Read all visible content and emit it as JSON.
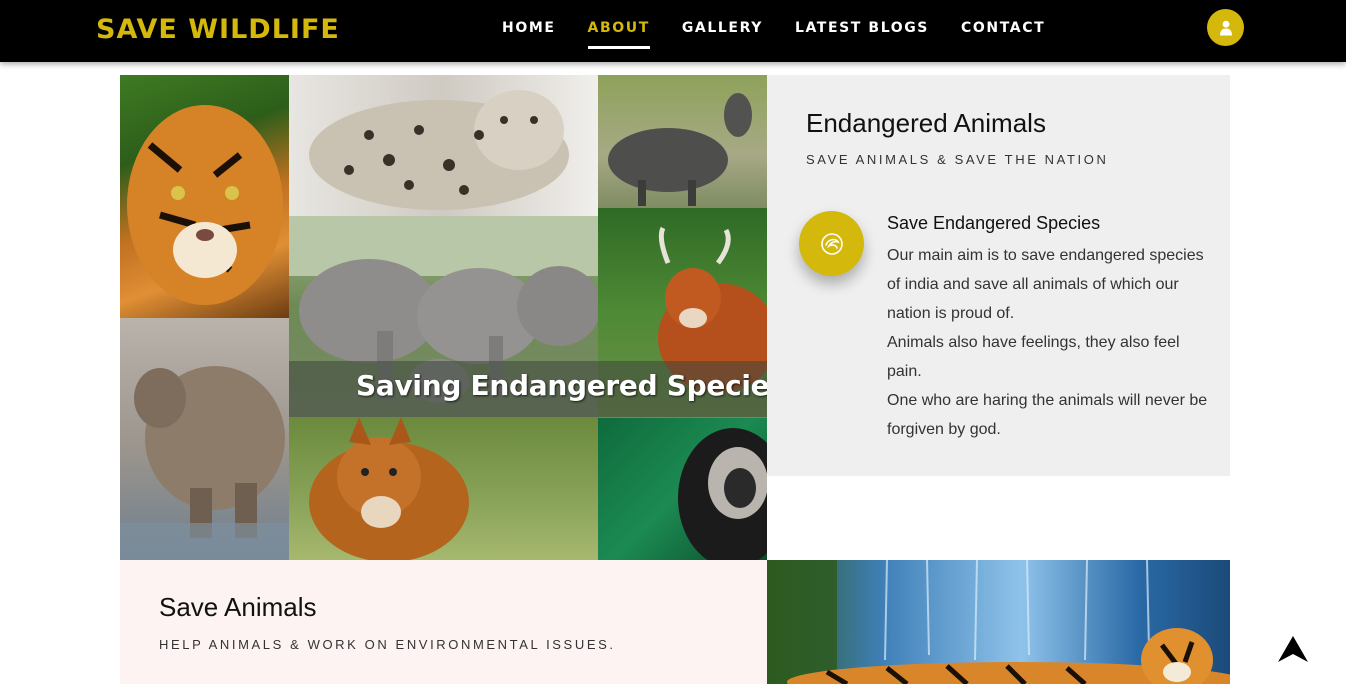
{
  "brand": "SAVE WILDLIFE",
  "nav": {
    "items": [
      {
        "label": "HOME",
        "active": false
      },
      {
        "label": "ABOUT",
        "active": true
      },
      {
        "label": "GALLERY",
        "active": false
      },
      {
        "label": "LATEST BLOGS",
        "active": false
      },
      {
        "label": "CONTACT",
        "active": false
      }
    ],
    "user_icon": "user-icon"
  },
  "hero": {
    "caption": "Saving Endangered Species"
  },
  "about": {
    "title": "Endangered Animals",
    "subtitle": "SAVE ANIMALS & SAVE THE NATION",
    "feature": {
      "icon": "leaf-swirl-icon",
      "title": "Save Endangered Species",
      "lines": [
        "Our main aim is to save endangered species of india and save all animals of which our nation is proud of.",
        "Animals also have feelings, they also feel pain.",
        "One who are haring the animals will never be forgiven by god."
      ]
    }
  },
  "save_animals": {
    "title": "Save Animals",
    "subtitle": "HELP ANIMALS & WORK ON ENVIRONMENTAL ISSUES."
  },
  "scroll_top_icon": "arrow-up-icon",
  "colors": {
    "accent": "#d4b80c",
    "nav_bg": "#000000",
    "panel_gray": "#efefef",
    "panel_pink": "#fdf3f2"
  }
}
